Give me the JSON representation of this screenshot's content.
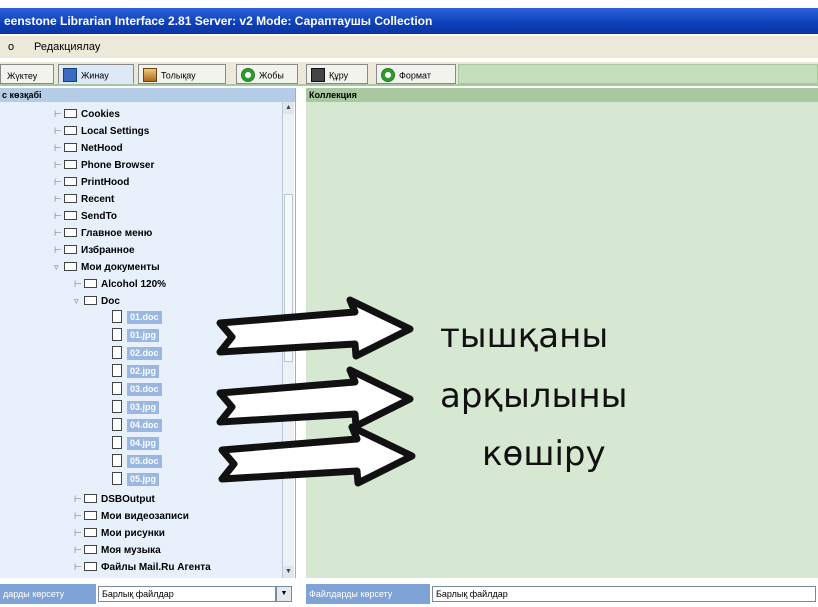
{
  "window": {
    "title": "eenstone Librarian Interface 2.81  Server: v2  Mode: Сараптаушы  Collection"
  },
  "menu": {
    "items": [
      "о",
      "Редакциялау"
    ]
  },
  "tabs": [
    {
      "label": "Жүктеу",
      "icon": "download-icon"
    },
    {
      "label": "Жинау",
      "icon": "gather-icon",
      "active": true
    },
    {
      "label": "Толықау",
      "icon": "enrich-icon"
    },
    {
      "label": "Жобы",
      "icon": "green-circle-icon"
    },
    {
      "label": "Құру",
      "icon": "create-icon"
    },
    {
      "label": "Формат",
      "icon": "green-circle-icon"
    }
  ],
  "left_pane": {
    "header": "с көзқабі",
    "tree": [
      {
        "label": "Cookies",
        "type": "folder",
        "level": 1
      },
      {
        "label": "Local Settings",
        "type": "folder",
        "level": 1
      },
      {
        "label": "NetHood",
        "type": "folder",
        "level": 1
      },
      {
        "label": "Phone Browser",
        "type": "folder",
        "level": 1
      },
      {
        "label": "PrintHood",
        "type": "folder",
        "level": 1
      },
      {
        "label": "Recent",
        "type": "folder",
        "level": 1
      },
      {
        "label": "SendTo",
        "type": "folder",
        "level": 1
      },
      {
        "label": "Главное меню",
        "type": "folder",
        "level": 1
      },
      {
        "label": "Избранное",
        "type": "folder",
        "level": 1
      },
      {
        "label": "Мои документы",
        "type": "folder",
        "level": 1,
        "expanded": true
      },
      {
        "label": "Alcohol 120%",
        "type": "folder",
        "level": 2
      },
      {
        "label": "Doc",
        "type": "folder",
        "level": 2,
        "expanded": true
      },
      {
        "label": "01.doc",
        "type": "file",
        "level": 3
      },
      {
        "label": "01.jpg",
        "type": "file",
        "level": 3
      },
      {
        "label": "02.doc",
        "type": "file",
        "level": 3
      },
      {
        "label": "02.jpg",
        "type": "file",
        "level": 3
      },
      {
        "label": "03.doc",
        "type": "file",
        "level": 3
      },
      {
        "label": "03.jpg",
        "type": "file",
        "level": 3
      },
      {
        "label": "04.doc",
        "type": "file",
        "level": 3
      },
      {
        "label": "04.jpg",
        "type": "file",
        "level": 3
      },
      {
        "label": "05.doc",
        "type": "file",
        "level": 3
      },
      {
        "label": "05.jpg",
        "type": "file",
        "level": 3
      },
      {
        "label": "DSBOutput",
        "type": "folder",
        "level": 2
      },
      {
        "label": "Мои видеозаписи",
        "type": "folder",
        "level": 2
      },
      {
        "label": "Мои рисунки",
        "type": "folder",
        "level": 2
      },
      {
        "label": "Моя музыка",
        "type": "folder",
        "level": 2
      },
      {
        "label": "Файлы Mail.Ru Агента",
        "type": "folder",
        "level": 2
      }
    ],
    "filter_label": "дарды көрсету",
    "filter_value": "Барлық файлдар"
  },
  "right_pane": {
    "header": "Коллекция",
    "filter_label": "Файлдарды көрсету",
    "filter_value": "Барлық файлдар"
  },
  "callout": {
    "lines": [
      "тышқаны",
      "арқылыны",
      "көшіру"
    ]
  }
}
